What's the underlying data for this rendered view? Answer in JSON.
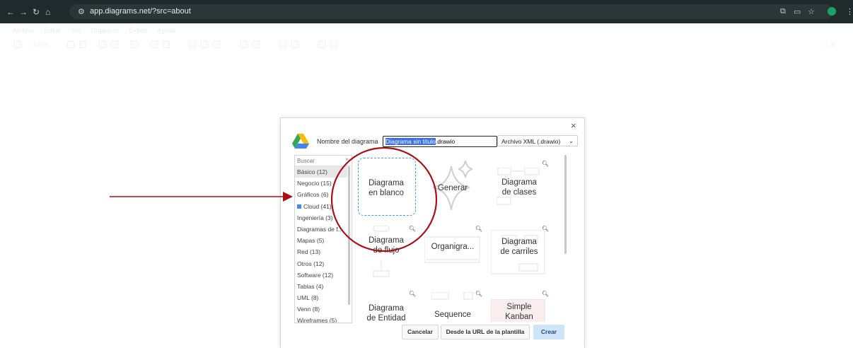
{
  "browser": {
    "url": "app.diagrams.net/?src=about"
  },
  "app_menu": [
    "Archivo",
    "Editar",
    "Ver",
    "Organizar",
    "Extras",
    "Ayuda"
  ],
  "app_zoom": "100%",
  "dialog": {
    "name_label": "Nombre del diagrama",
    "name_selected": "Diagrama sin título",
    "name_ext": ".drawio",
    "format": "Archivo XML (.drawio)",
    "search_placeholder": "Buscar",
    "categories": [
      "Básico (12)",
      "Negocio (15)",
      "Gráficos (6)",
      "Cloud (41)",
      "Ingeniería (3)",
      "Diagramas de f...",
      "Mapas (5)",
      "Red (13)",
      "Otros (12)",
      "Software (12)",
      "Tablas (4)",
      "UML (8)",
      "Venn (8)",
      "Wireframes (5)"
    ],
    "templates": {
      "blank_line1": "Diagrama",
      "blank_line2": "en blanco",
      "generate": "Generar",
      "classes_line1": "Diagrama",
      "classes_line2": "de clases",
      "flow_line1": "Diagrama",
      "flow_line2": "de flujo",
      "org": "Organigra...",
      "swim_line1": "Diagrama",
      "swim_line2": "de carriles",
      "er_line1": "Diagrama",
      "er_line2": "de Entidad",
      "sequence": "Sequence",
      "kanban_line1": "Simple",
      "kanban_line2": "Kanban"
    },
    "buttons": {
      "cancel": "Cancelar",
      "from_url": "Desde la URL de la plantilla",
      "create": "Crear"
    }
  },
  "colors": {
    "annotation": "#a61016",
    "accent": "#3a6ff0",
    "dashed": "#4a9be6"
  }
}
